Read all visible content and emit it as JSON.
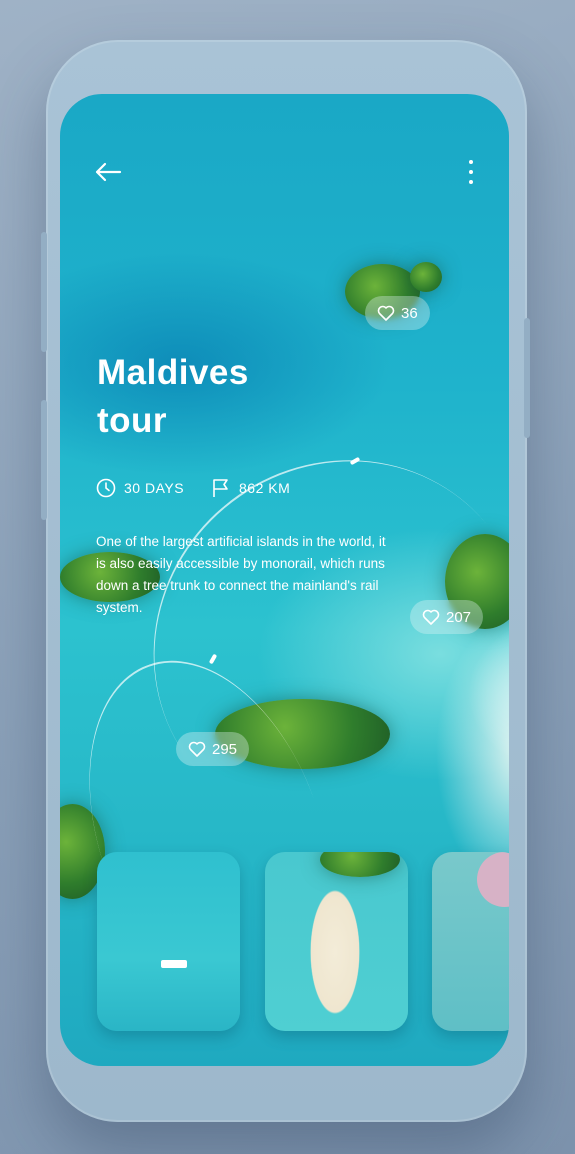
{
  "header": {
    "back_icon": "arrow-left-icon",
    "menu_icon": "more-vertical-icon"
  },
  "tour": {
    "title_line1": "Maldives",
    "title_line2": "tour",
    "duration": "30 DAYS",
    "distance": "862 KM",
    "description": "One of the largest artificial islands in the world, it is also easily accessible by monorail, which runs down a tree trunk to connect the mainland's rail system."
  },
  "likes": [
    {
      "count": "36"
    },
    {
      "count": "207"
    },
    {
      "count": "295"
    }
  ],
  "gallery": [
    "Boat on turquoise water",
    "Sandbar with people",
    "Coast with coral"
  ],
  "colors": {
    "water": "#1fb3cc",
    "text": "#ffffff",
    "frame": "#9db8cc"
  }
}
